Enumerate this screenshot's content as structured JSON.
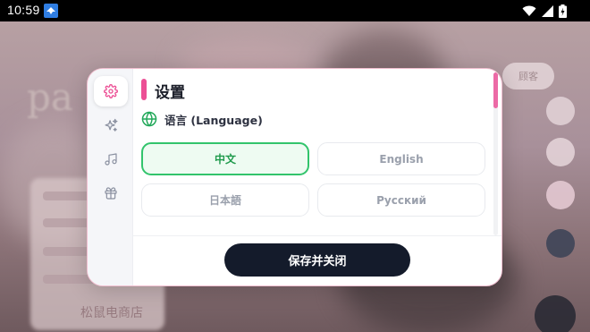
{
  "status_bar": {
    "time": "10:59",
    "icons": [
      "app-notification-icon",
      "wifi-icon",
      "cellular-signal-icon",
      "battery-icon"
    ]
  },
  "background_app": {
    "logo_text": "pa",
    "pill_label": "顾客",
    "footer_text": "松鼠电商店"
  },
  "settings_dialog": {
    "title": "设置",
    "accent_color": "#ec4f95",
    "sidebar": [
      {
        "icon": "gear-icon",
        "active": true
      },
      {
        "icon": "sparkles-icon",
        "active": false
      },
      {
        "icon": "music-note-icon",
        "active": false
      },
      {
        "icon": "gift-icon",
        "active": false
      }
    ],
    "language_section": {
      "label": "语言 (Language)",
      "icon": "globe-icon",
      "options": [
        {
          "label": "中文",
          "selected": true
        },
        {
          "label": "English",
          "selected": false
        },
        {
          "label": "日本語",
          "selected": false
        },
        {
          "label": "Русский",
          "selected": false
        }
      ],
      "selected_color": "#32c46c"
    },
    "save_button_label": "保存并关闭"
  }
}
